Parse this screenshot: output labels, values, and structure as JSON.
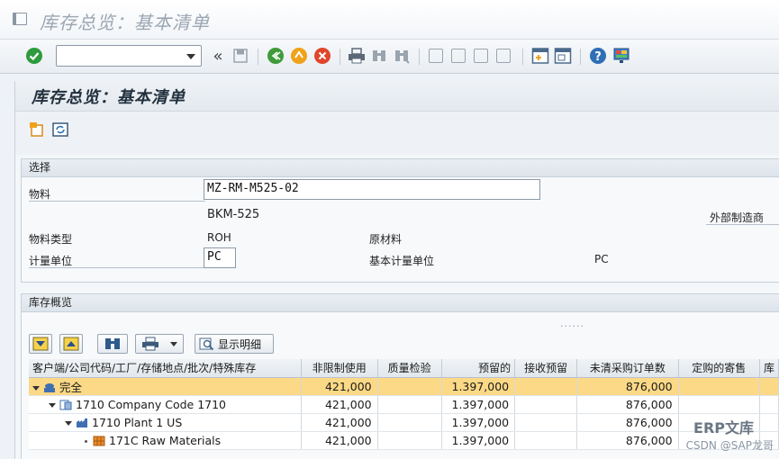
{
  "window": {
    "title": "库存总览：基本清单"
  },
  "toolbar": {
    "command_value": "",
    "icons": [
      "check-icon",
      "command-dropdown",
      "back-double-icon",
      "save-icon",
      "back-icon",
      "exit-icon",
      "cancel-icon",
      "print-icon",
      "find-icon",
      "find-next-icon",
      "first-page-icon",
      "prev-page-icon",
      "next-page-icon",
      "last-page-icon",
      "create-session-icon",
      "shortcut-icon",
      "help-icon",
      "layout-icon"
    ]
  },
  "screen": {
    "title": "库存总览：基本清单"
  },
  "selection": {
    "heading": "选择",
    "material_label": "物料",
    "material_value": "MZ-RM-M525-02",
    "material_desc": "BKM-525",
    "ext_mfr_label": "外部制造商",
    "material_type_label": "物料类型",
    "material_type_code": "ROH",
    "material_type_desc": "原材料",
    "unit_label": "计量单位",
    "unit_value": "PC",
    "base_unit_label": "基本计量单位",
    "base_unit_value": "PC"
  },
  "overview": {
    "heading": "库存概览",
    "splitter": "......",
    "show_details_label": "显示明细",
    "columns": [
      "客户端/公司代码/工厂/存储地点/批次/特殊库存",
      "非限制使用",
      "质量检验",
      "预留的",
      "接收预留",
      "未清采购订单数",
      "定购的寄售",
      "库"
    ],
    "rows": [
      {
        "name": "完全",
        "level": 0,
        "unrestricted": "421,000",
        "quality": "",
        "reserved": "1.397,000",
        "receipt_res": "",
        "open_po": "876,000",
        "consign": ""
      },
      {
        "name": "1710 Company Code 1710",
        "level": 1,
        "unrestricted": "421,000",
        "quality": "",
        "reserved": "1.397,000",
        "receipt_res": "",
        "open_po": "876,000",
        "consign": ""
      },
      {
        "name": "1710 Plant 1 US",
        "level": 2,
        "unrestricted": "421,000",
        "quality": "",
        "reserved": "1.397,000",
        "receipt_res": "",
        "open_po": "876,000",
        "consign": ""
      },
      {
        "name": "171C Raw Materials",
        "level": 3,
        "unrestricted": "421,000",
        "quality": "",
        "reserved": "1.397,000",
        "receipt_res": "",
        "open_po": "876,000",
        "consign": ""
      }
    ]
  },
  "watermark": {
    "brand": "ERP文库",
    "credit": "CSDN @SAP龙哥"
  },
  "colors": {
    "selected_row": "#fcd986",
    "check": "#2e9b3e",
    "exit": "#f0a21a",
    "cancel": "#e0462c"
  }
}
